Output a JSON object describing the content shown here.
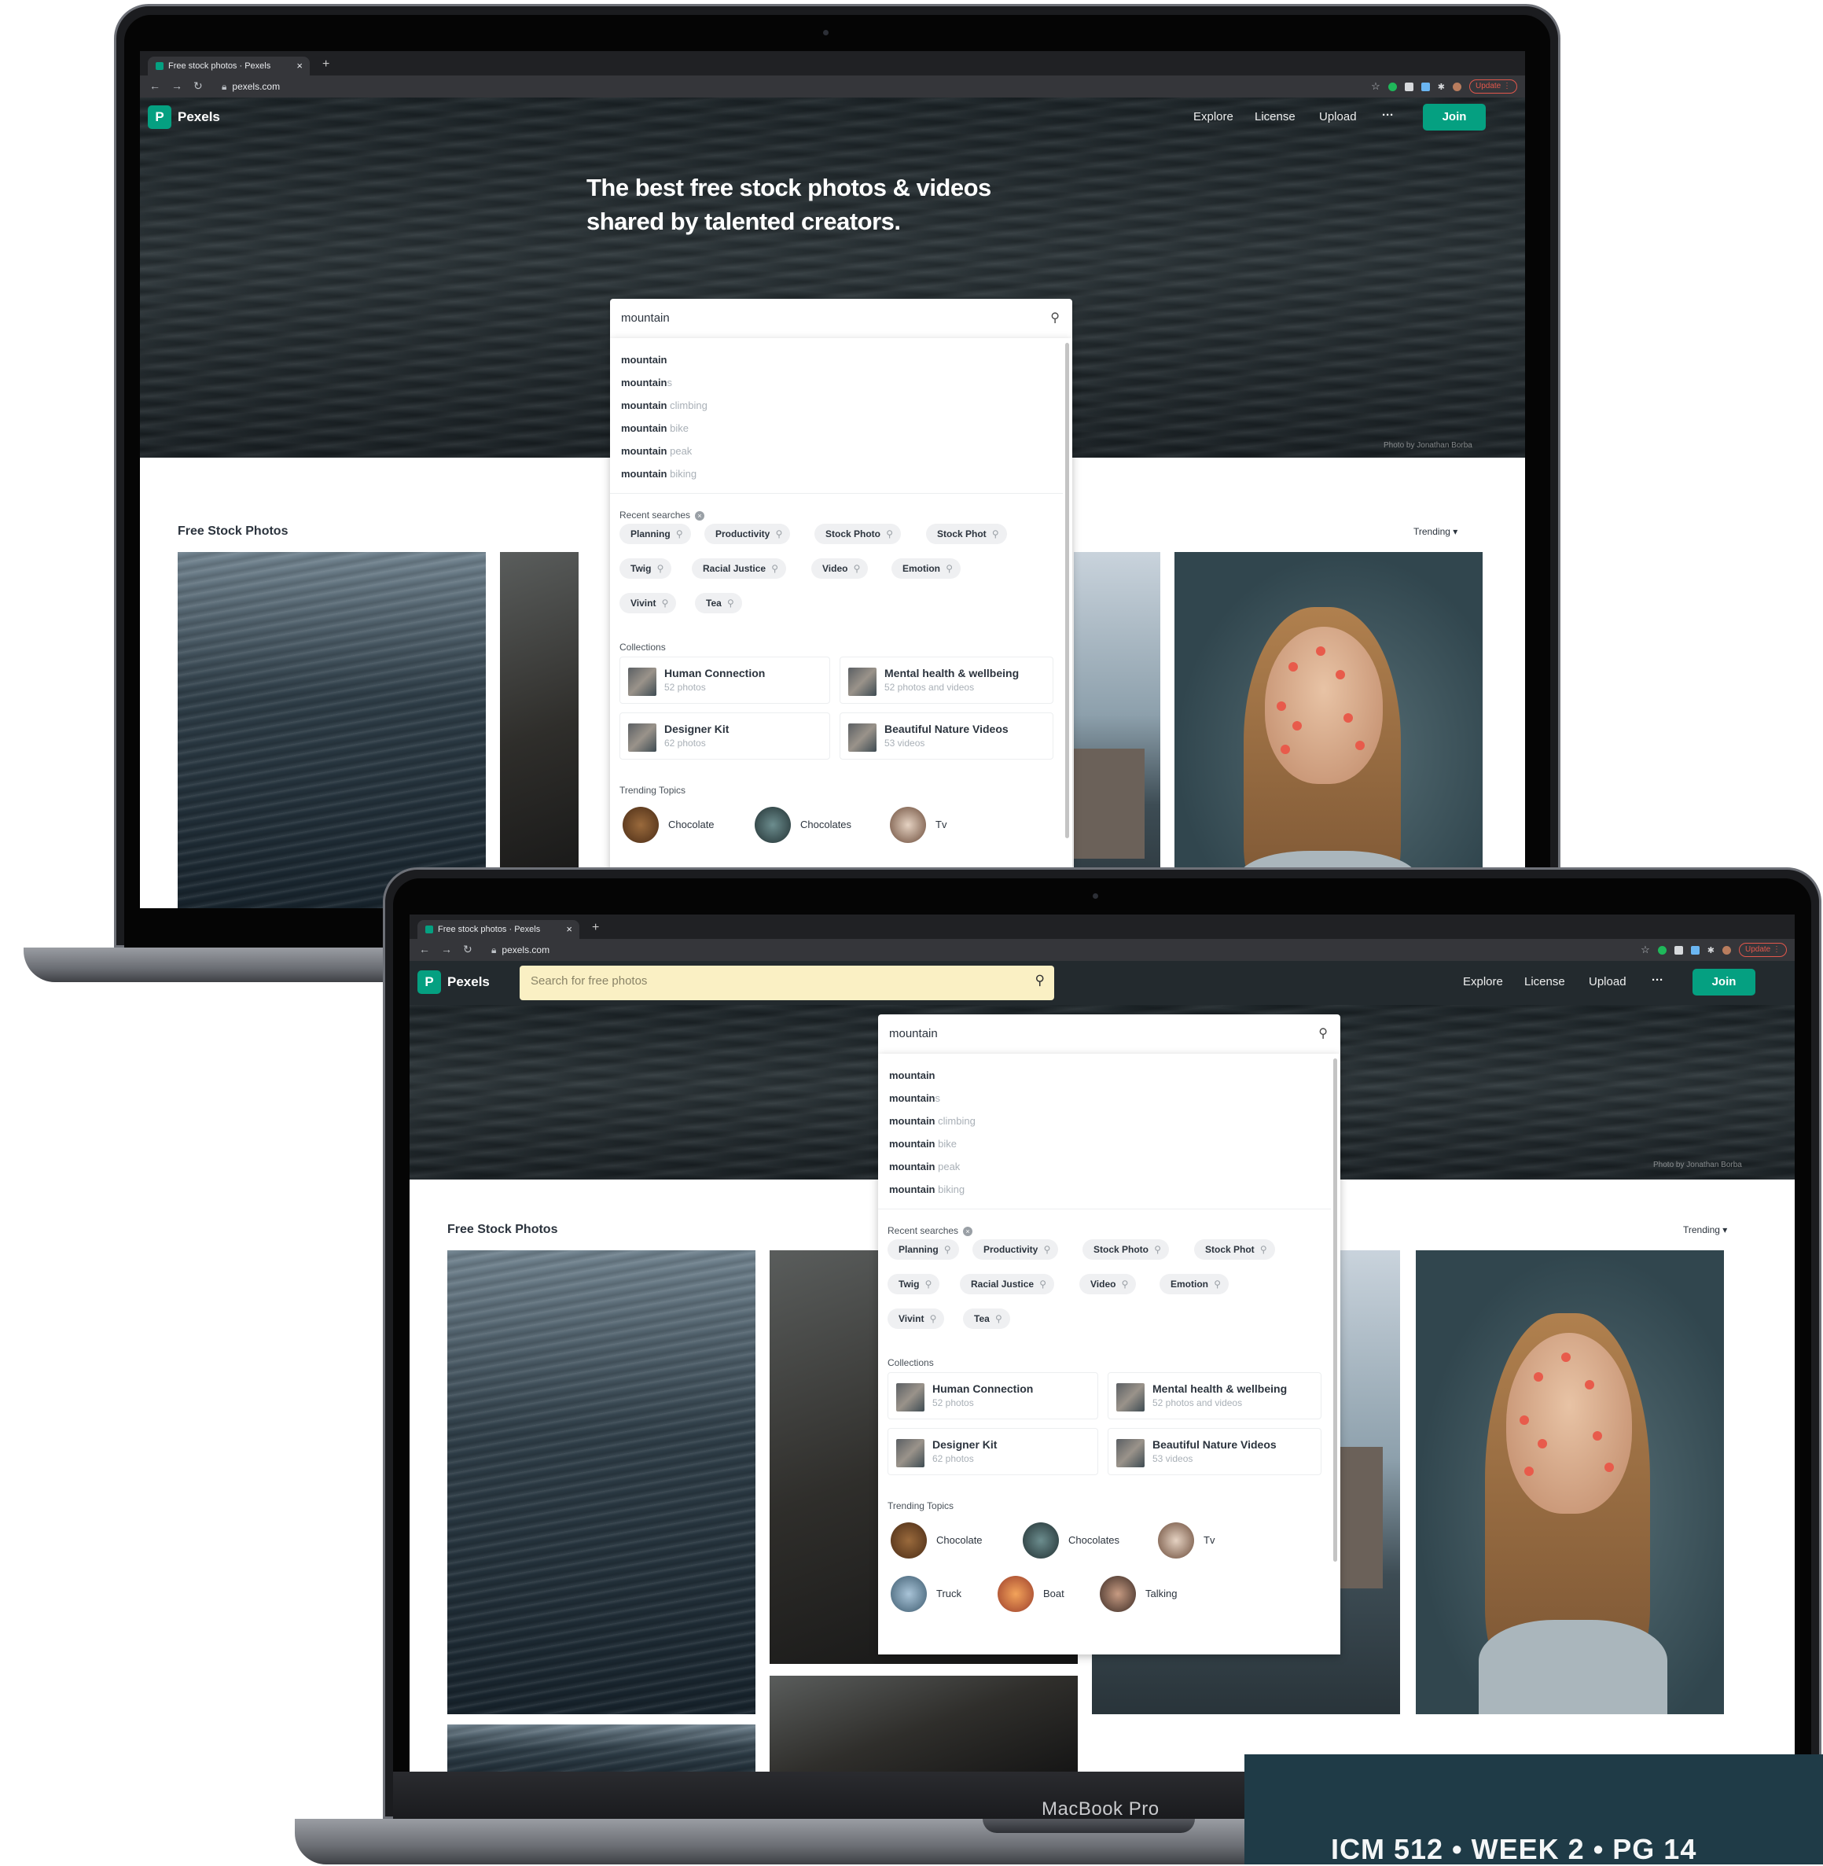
{
  "browser": {
    "tab_title": "Free stock photos · Pexels",
    "url": "pexels.com",
    "update_label": "Update"
  },
  "site": {
    "name": "Pexels",
    "logo_letter": "P",
    "nav": [
      "Explore",
      "License",
      "Upload"
    ],
    "more": "···",
    "join": "Join",
    "headline_1": "The best free stock photos & videos",
    "headline_2": "shared by talented creators.",
    "photo_credit": "Photo by Jonathan Borba",
    "nav_search_placeholder": "Search for free photos",
    "section_title": "Free Stock Photos",
    "sort": "Trending ▾"
  },
  "search": {
    "value": "mountain",
    "suggestions": [
      {
        "bold": "mountain",
        "rest": ""
      },
      {
        "bold": "mountain",
        "rest": "s"
      },
      {
        "bold": "mountain",
        "rest": " climbing"
      },
      {
        "bold": "mountain",
        "rest": " bike"
      },
      {
        "bold": "mountain",
        "rest": " peak"
      },
      {
        "bold": "mountain",
        "rest": " biking"
      }
    ],
    "recent_label": "Recent searches",
    "recent": [
      "Planning",
      "Productivity",
      "Stock Photo",
      "Stock Phot",
      "Twig",
      "Racial Justice",
      "Video",
      "Emotion",
      "Vivint",
      "Tea"
    ],
    "collections_label": "Collections",
    "collections": [
      {
        "title": "Human Connection",
        "count": "52 photos"
      },
      {
        "title": "Mental health & wellbeing",
        "count": "52 photos and videos"
      },
      {
        "title": "Designer Kit",
        "count": "62 photos"
      },
      {
        "title": "Beautiful Nature Videos",
        "count": "53 videos"
      }
    ],
    "trending_label": "Trending Topics",
    "topics": [
      "Chocolate",
      "Chocolates",
      "Tv",
      "Truck",
      "Boat",
      "Talking"
    ]
  },
  "device_label": "MacBook Pro",
  "footer": "ICM 512 • WEEK 2 • PG 14",
  "colors": {
    "brand": "#05a081",
    "banner": "#1f3b47",
    "nav_search_bg": "#faf0c4"
  }
}
